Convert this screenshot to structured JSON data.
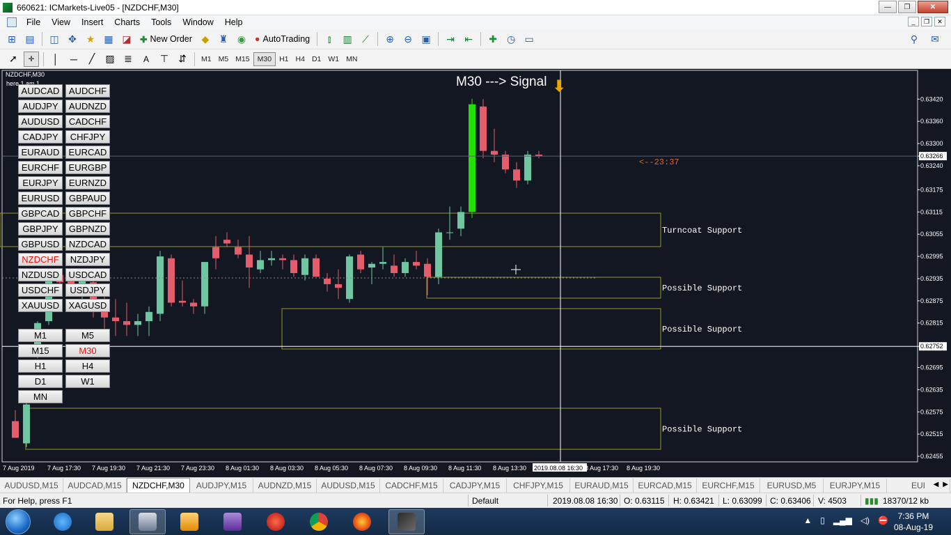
{
  "window": {
    "title": "660621: ICMarkets-Live05 - [NZDCHF,M30]",
    "minimize": "—",
    "maximize": "❐",
    "close": "✕"
  },
  "menu": [
    "File",
    "View",
    "Insert",
    "Charts",
    "Tools",
    "Window",
    "Help"
  ],
  "toolbar": {
    "new_order": "New Order",
    "auto_trading": "AutoTrading",
    "timeframes": [
      "M1",
      "M5",
      "M15",
      "M30",
      "H1",
      "H4",
      "D1",
      "W1",
      "MN"
    ],
    "active_timeframe": "M30"
  },
  "chart": {
    "tag": "NZDCHF,M30",
    "here_text": "here 1 am 1",
    "signal_text": "M30 ---> Signal",
    "countdown": "<--23:37",
    "price_labels": [
      "0.63420",
      "0.63360",
      "0.63300",
      "0.63266",
      "0.63240",
      "0.63175",
      "0.63115",
      "0.63055",
      "0.62995",
      "0.62935",
      "0.62875",
      "0.62815",
      "0.62752",
      "0.62695",
      "0.62635",
      "0.62575",
      "0.62515",
      "0.62455"
    ],
    "current_price": "0.63266",
    "crosshair_price": "0.62752",
    "time_labels": [
      "7 Aug 2019",
      "7 Aug 17:30",
      "7 Aug 19:30",
      "7 Aug 21:30",
      "7 Aug 23:30",
      "8 Aug 01:30",
      "8 Aug 03:30",
      "8 Aug 05:30",
      "8 Aug 07:30",
      "8 Aug 09:30",
      "8 Aug 11:30",
      "8 Aug 13:30",
      "2019.08.08 16:30",
      "8 Aug 17:30",
      "8 Aug 19:30"
    ],
    "zones": [
      {
        "label": "Turncoat Support"
      },
      {
        "label": "Possible Support"
      },
      {
        "label": "Possible Support"
      },
      {
        "label": "Possible Support"
      }
    ]
  },
  "symbol_buttons": [
    [
      "AUDCAD",
      "AUDCHF"
    ],
    [
      "AUDJPY",
      "AUDNZD"
    ],
    [
      "AUDUSD",
      "CADCHF"
    ],
    [
      "CADJPY",
      "CHFJPY"
    ],
    [
      "EURAUD",
      "EURCAD"
    ],
    [
      "EURCHF",
      "EURGBP"
    ],
    [
      "EURJPY",
      "EURNZD"
    ],
    [
      "EURUSD",
      "GBPAUD"
    ],
    [
      "GBPCAD",
      "GBPCHF"
    ],
    [
      "GBPJPY",
      "GBPNZD"
    ],
    [
      "GBPUSD",
      "NZDCAD"
    ],
    [
      "NZDCHF",
      "NZDJPY"
    ],
    [
      "NZDUSD",
      "USDCAD"
    ],
    [
      "USDCHF",
      "USDJPY"
    ],
    [
      "XAUUSD",
      "XAGUSD"
    ]
  ],
  "active_symbol": "NZDCHF",
  "tf_buttons": [
    [
      "M1",
      "M5"
    ],
    [
      "M15",
      "M30"
    ],
    [
      "H1",
      "H4"
    ],
    [
      "D1",
      "W1"
    ],
    [
      "MN"
    ]
  ],
  "tabs": [
    "AUDUSD,M15",
    "AUDCAD,M15",
    "NZDCHF,M30",
    "AUDJPY,M15",
    "AUDNZD,M15",
    "AUDUSD,M15",
    "CADCHF,M15",
    "CADJPY,M15",
    "CHFJPY,M15",
    "EURAUD,M15",
    "EURCAD,M15",
    "EURCHF,M15",
    "EURUSD,M5",
    "EURJPY,M15",
    "EUI"
  ],
  "active_tab": "NZDCHF,M30",
  "status": {
    "help": "For Help, press F1",
    "profile": "Default",
    "datetime": "2019.08.08 16:30",
    "open": "O: 0.63115",
    "high": "H: 0.63421",
    "low": "L: 0.63099",
    "close": "C: 0.63406",
    "volume": "V: 4503",
    "traffic": "18370/12 kb"
  },
  "taskbar": {
    "time": "7:36 PM",
    "date": "08-Aug-19"
  },
  "colors": {
    "bull": "#6fc7a1",
    "bear": "#e45d6c",
    "signal_bull": "#22e000",
    "zone": "#9a9a26",
    "background": "#131722"
  },
  "chart_data": {
    "type": "candlestick",
    "bars": [
      {
        "o": 0.6255,
        "h": 0.6258,
        "l": 0.62505,
        "c": 0.62505
      },
      {
        "o": 0.6249,
        "h": 0.626,
        "l": 0.6248,
        "c": 0.62595
      },
      {
        "o": 0.62735,
        "h": 0.6282,
        "l": 0.6272,
        "c": 0.62815
      },
      {
        "o": 0.6282,
        "h": 0.6294,
        "l": 0.6281,
        "c": 0.6294
      },
      {
        "o": 0.62945,
        "h": 0.6296,
        "l": 0.6291,
        "c": 0.62925
      },
      {
        "o": 0.6293,
        "h": 0.6295,
        "l": 0.629,
        "c": 0.62915
      },
      {
        "o": 0.6292,
        "h": 0.6294,
        "l": 0.6288,
        "c": 0.6293
      },
      {
        "o": 0.62925,
        "h": 0.6294,
        "l": 0.6283,
        "c": 0.6288
      },
      {
        "o": 0.6288,
        "h": 0.629,
        "l": 0.628,
        "c": 0.6283
      },
      {
        "o": 0.6283,
        "h": 0.6288,
        "l": 0.6278,
        "c": 0.6282
      },
      {
        "o": 0.6282,
        "h": 0.6287,
        "l": 0.6278,
        "c": 0.6281
      },
      {
        "o": 0.6281,
        "h": 0.6284,
        "l": 0.6278,
        "c": 0.6282
      },
      {
        "o": 0.6282,
        "h": 0.6286,
        "l": 0.6278,
        "c": 0.62845
      },
      {
        "o": 0.6284,
        "h": 0.6301,
        "l": 0.6282,
        "c": 0.62995
      },
      {
        "o": 0.6299,
        "h": 0.63,
        "l": 0.6286,
        "c": 0.6287
      },
      {
        "o": 0.62875,
        "h": 0.6293,
        "l": 0.6286,
        "c": 0.6287
      },
      {
        "o": 0.6287,
        "h": 0.6288,
        "l": 0.6284,
        "c": 0.6286
      },
      {
        "o": 0.6286,
        "h": 0.6298,
        "l": 0.6284,
        "c": 0.6298
      },
      {
        "o": 0.6302,
        "h": 0.6305,
        "l": 0.6296,
        "c": 0.6299
      },
      {
        "o": 0.6304,
        "h": 0.6306,
        "l": 0.6302,
        "c": 0.6303
      },
      {
        "o": 0.6302,
        "h": 0.6304,
        "l": 0.6299,
        "c": 0.63
      },
      {
        "o": 0.63,
        "h": 0.6305,
        "l": 0.6291,
        "c": 0.62965
      },
      {
        "o": 0.6296,
        "h": 0.6301,
        "l": 0.6295,
        "c": 0.62985
      },
      {
        "o": 0.62985,
        "h": 0.6301,
        "l": 0.6297,
        "c": 0.6299
      },
      {
        "o": 0.6299,
        "h": 0.63,
        "l": 0.6296,
        "c": 0.62985
      },
      {
        "o": 0.62985,
        "h": 0.63,
        "l": 0.6294,
        "c": 0.6295
      },
      {
        "o": 0.62945,
        "h": 0.63,
        "l": 0.6293,
        "c": 0.6299
      },
      {
        "o": 0.6299,
        "h": 0.63,
        "l": 0.6294,
        "c": 0.6294
      },
      {
        "o": 0.62935,
        "h": 0.6295,
        "l": 0.629,
        "c": 0.6292
      },
      {
        "o": 0.6292,
        "h": 0.6296,
        "l": 0.6288,
        "c": 0.6291
      },
      {
        "o": 0.6288,
        "h": 0.63,
        "l": 0.6287,
        "c": 0.62995
      },
      {
        "o": 0.63,
        "h": 0.6301,
        "l": 0.6295,
        "c": 0.6296
      },
      {
        "o": 0.62965,
        "h": 0.6298,
        "l": 0.6292,
        "c": 0.62975
      },
      {
        "o": 0.62975,
        "h": 0.6302,
        "l": 0.6296,
        "c": 0.6298
      },
      {
        "o": 0.6297,
        "h": 0.63,
        "l": 0.6294,
        "c": 0.6295
      },
      {
        "o": 0.6295,
        "h": 0.6299,
        "l": 0.6294,
        "c": 0.6298
      },
      {
        "o": 0.6298,
        "h": 0.6301,
        "l": 0.6296,
        "c": 0.6297
      },
      {
        "o": 0.62975,
        "h": 0.6299,
        "l": 0.6289,
        "c": 0.6294
      },
      {
        "o": 0.6294,
        "h": 0.6307,
        "l": 0.6292,
        "c": 0.6306
      },
      {
        "o": 0.6306,
        "h": 0.6313,
        "l": 0.6304,
        "c": 0.6306
      },
      {
        "o": 0.6307,
        "h": 0.6313,
        "l": 0.6305,
        "c": 0.63115
      },
      {
        "o": 0.63115,
        "h": 0.63421,
        "l": 0.63099,
        "c": 0.63406
      },
      {
        "o": 0.634,
        "h": 0.6342,
        "l": 0.6326,
        "c": 0.6328
      },
      {
        "o": 0.6328,
        "h": 0.6334,
        "l": 0.6325,
        "c": 0.6327
      },
      {
        "o": 0.6327,
        "h": 0.6328,
        "l": 0.6322,
        "c": 0.6323
      },
      {
        "o": 0.6323,
        "h": 0.6325,
        "l": 0.6318,
        "c": 0.632
      },
      {
        "o": 0.632,
        "h": 0.6328,
        "l": 0.6319,
        "c": 0.6327
      },
      {
        "o": 0.6327,
        "h": 0.6328,
        "l": 0.6326,
        "c": 0.63266
      }
    ],
    "ylim": [
      0.6244,
      0.6346
    ]
  }
}
